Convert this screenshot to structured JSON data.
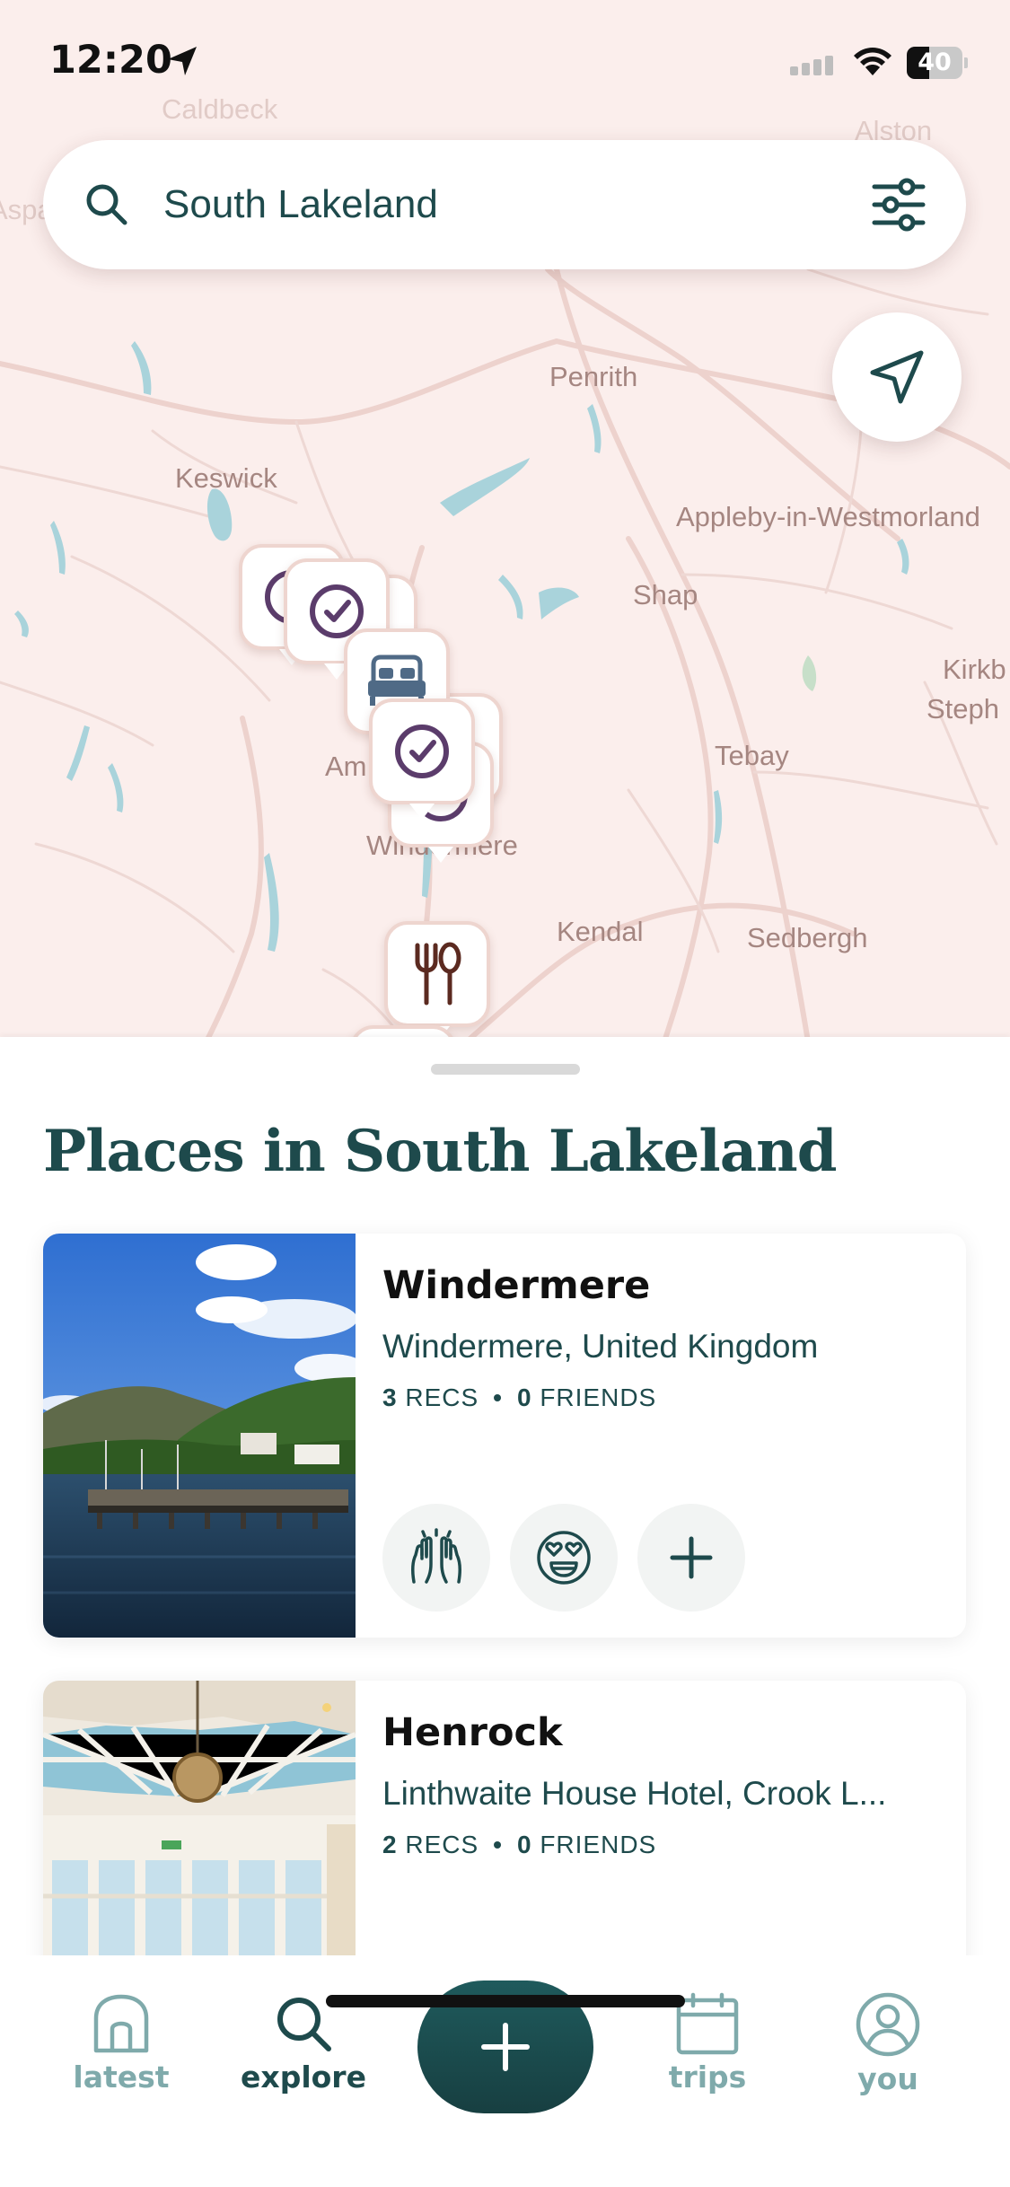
{
  "status_bar": {
    "time": "12:20",
    "battery": "40",
    "battery_level": 0.4
  },
  "map": {
    "search": {
      "value": "South Lakeland"
    },
    "towns": {
      "keswick": "Keswick",
      "penrith": "Penrith",
      "appleby": "Appleby-in-Westmorland",
      "shap": "Shap",
      "tebay": "Tebay",
      "kendal": "Kendal",
      "sedbergh": "Sedbergh",
      "windermere": "Windermere",
      "ambleside": "Am",
      "kirkby_line1": "Kirkb",
      "kirkby_line2": "Steph",
      "faint_left": "Aspa",
      "faint_top": "Alston",
      "faint_top2": "Caldbeck"
    },
    "pins": {
      "visited": "check-circle-icon",
      "stay": "bed-icon",
      "food": "fork-spoon-icon"
    },
    "colors": {
      "land": "#fbeeec",
      "water": "#a9d3db",
      "road": "#edd2cd",
      "pin_border": "#eed5cf",
      "check_purple": "#5b3c6b",
      "bed_blue": "#4f6a86",
      "food_brown": "#5b2a20"
    }
  },
  "sheet": {
    "title": "Places in South Lakeland",
    "places": [
      {
        "name": "Windermere",
        "location": "Windermere, United Kingdom",
        "recs_count": "3",
        "recs_label": "RECS",
        "friends_count": "0",
        "friends_label": "FRIENDS",
        "separator": "•",
        "reactions": [
          "raised-hands-icon",
          "heart-eyes-icon",
          "add-icon"
        ]
      },
      {
        "name": "Henrock",
        "location": "Linthwaite House Hotel, Crook L...",
        "recs_count": "2",
        "recs_label": "RECS",
        "friends_count": "0",
        "friends_label": "FRIENDS",
        "separator": "•"
      }
    ]
  },
  "tab_bar": {
    "tabs": [
      {
        "label": "latest",
        "icon": "home-icon",
        "active": false
      },
      {
        "label": "explore",
        "icon": "search-icon",
        "active": true
      },
      {
        "label": "add",
        "icon": "plus-icon",
        "active": false
      },
      {
        "label": "trips",
        "icon": "calendar-icon",
        "active": false
      },
      {
        "label": "you",
        "icon": "profile-icon",
        "active": false
      }
    ],
    "colors": {
      "active": "#1e4a4c",
      "inactive": "#7faaab",
      "fab": "#1f5a5c"
    }
  }
}
